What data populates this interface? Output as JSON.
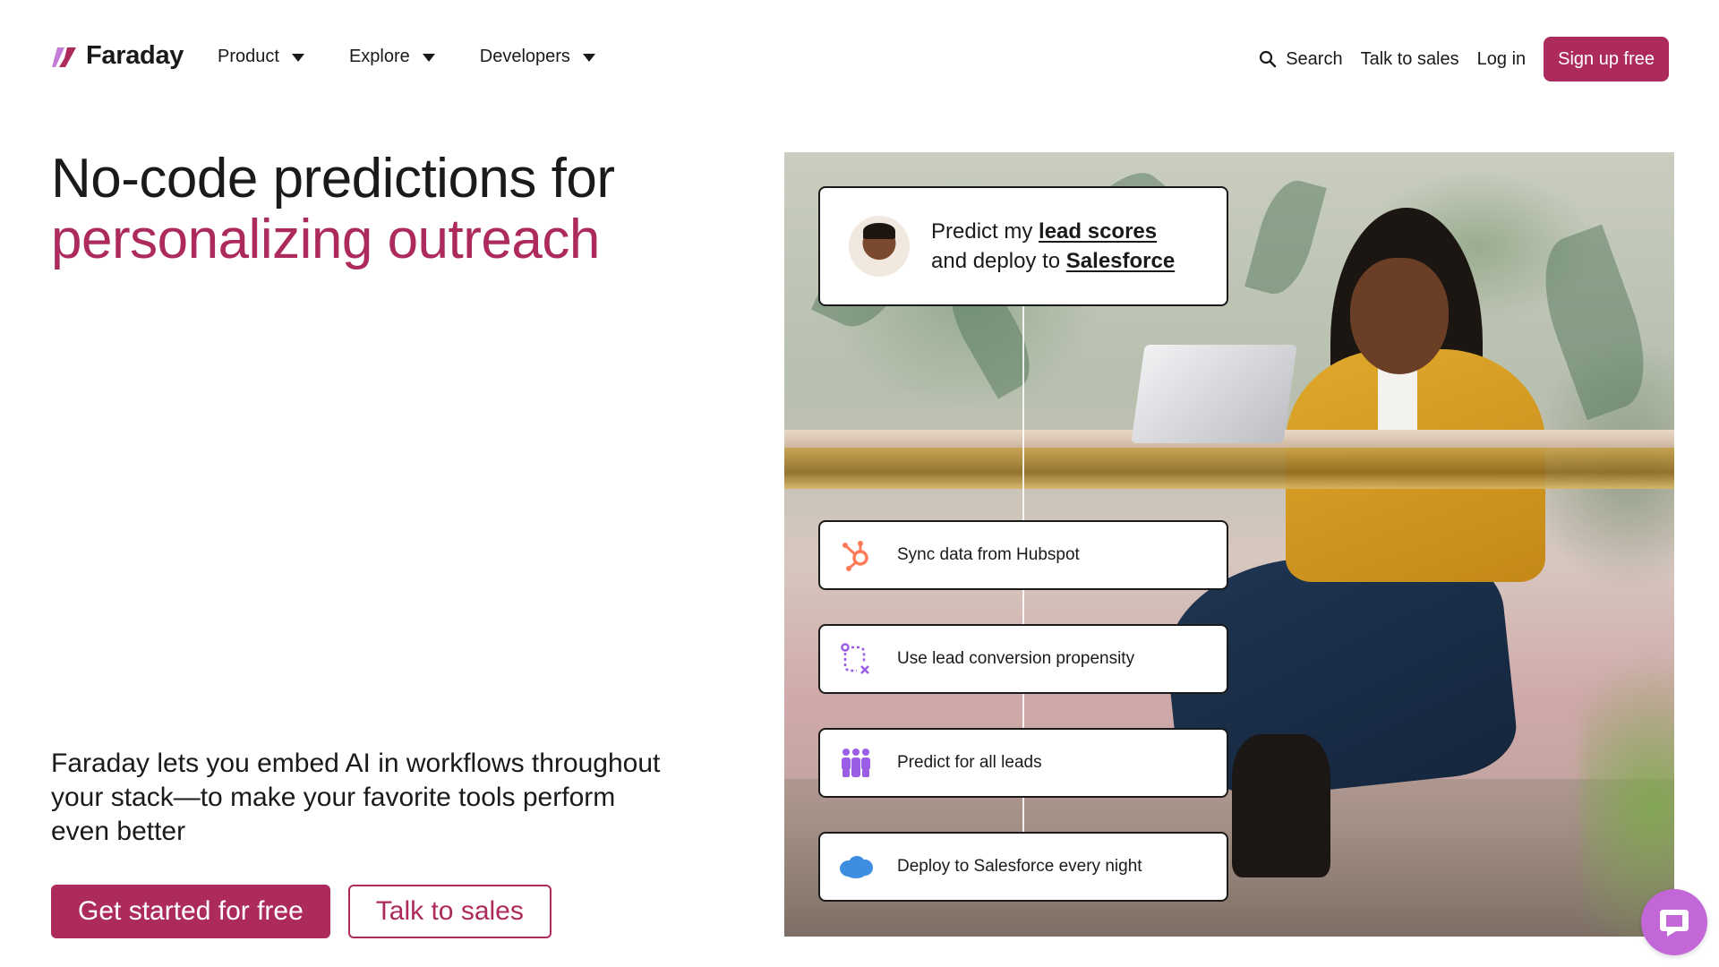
{
  "brand": {
    "name": "Faraday",
    "accent": "#ad2b5c",
    "logo_icon": "faraday-bolt-logo"
  },
  "nav": {
    "menu": [
      {
        "label": "Product"
      },
      {
        "label": "Explore"
      },
      {
        "label": "Developers"
      }
    ],
    "search_label": "Search",
    "talk_to_sales": "Talk to sales",
    "log_in": "Log in",
    "sign_up": "Sign up free"
  },
  "hero": {
    "headline_line1": "No-code predictions for",
    "headline_line2": "personalizing outreach",
    "subtext": "Faraday lets you embed AI in workflows throughout your stack—to make your favorite tools perform even better",
    "cta_primary": "Get started for free",
    "cta_secondary": "Talk to sales"
  },
  "workflow_card": {
    "prefix1": "Predict my ",
    "highlight1": "lead scores",
    "prefix2": "and deploy to ",
    "highlight2": "Salesforce"
  },
  "steps": [
    {
      "label": "Sync data from Hubspot",
      "icon": "hubspot-icon",
      "color": "#ff7a59"
    },
    {
      "label": "Use lead conversion propensity",
      "icon": "conversion-flow-icon",
      "color": "#9b5de5"
    },
    {
      "label": "Predict for all leads",
      "icon": "people-group-icon",
      "color": "#9b5de5"
    },
    {
      "label": "Deploy to Salesforce every night",
      "icon": "salesforce-cloud-icon",
      "color": "#00a1e0"
    }
  ],
  "chat": {
    "icon": "chat-bubble-icon",
    "color": "#c266d8"
  }
}
